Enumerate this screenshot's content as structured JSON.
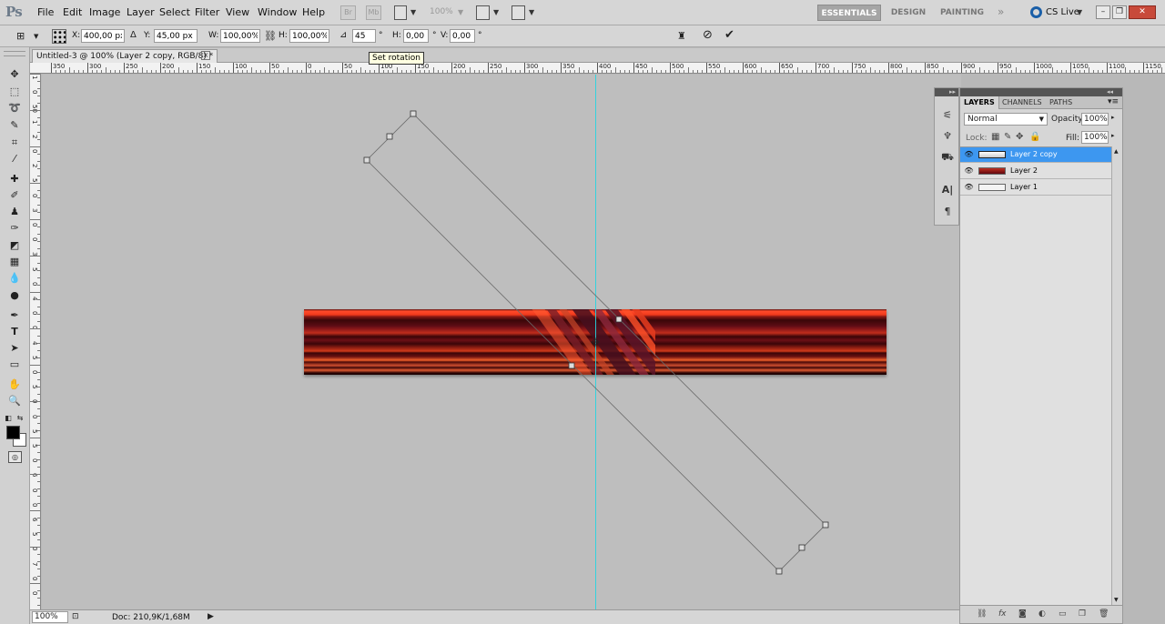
{
  "app": {
    "logo": "Ps"
  },
  "menu": [
    "File",
    "Edit",
    "Image",
    "Layer",
    "Select",
    "Filter",
    "View",
    "Window",
    "Help"
  ],
  "menubar": {
    "zoom": "100%",
    "workspaces": [
      "ESSENTIALS",
      "DESIGN",
      "PAINTING"
    ],
    "more": "»",
    "cs_live": "CS Live",
    "window_controls": [
      "–",
      "❐",
      "✕"
    ]
  },
  "options": {
    "x_label": "X:",
    "x_value": "400,00 px",
    "y_label": "Y:",
    "y_value": "45,00 px",
    "w_label": "W:",
    "w_value": "100,00%",
    "h_label": "H:",
    "h_value": "100,00%",
    "angle_value": "45",
    "degree": "°",
    "hskew_label": "H:",
    "hskew_value": "0,00",
    "vskew_label": "V:",
    "vskew_value": "0,00",
    "tooltip": "Set rotation"
  },
  "document": {
    "tab_title": "Untitled-3 @ 100% (Layer 2 copy, RGB/8) *",
    "close": "×"
  },
  "rulers": {
    "h_labels": [
      "350",
      "300",
      "250",
      "200",
      "150",
      "100",
      "50",
      "0",
      "50",
      "100",
      "150",
      "200",
      "250",
      "300",
      "350",
      "400",
      "450",
      "500",
      "550",
      "600",
      "650",
      "700",
      "750",
      "800",
      "850",
      "900",
      "950",
      "1000",
      "1050",
      "1100",
      "1150"
    ],
    "v_labels": [
      "1",
      "0",
      "50",
      "1",
      "2",
      "0",
      "2",
      "5",
      "0",
      "3",
      "0",
      "0",
      "3",
      "5",
      "0",
      "4",
      "0",
      "0",
      "4",
      "5",
      "0",
      "5",
      "0",
      "0",
      "5",
      "5",
      "0",
      "6",
      "0",
      "0",
      "6",
      "5",
      "0",
      "7",
      "0",
      "0"
    ]
  },
  "status": {
    "zoom": "100%",
    "doc": "Doc: 210,9K/1,68M",
    "arrow": "▶"
  },
  "layers": {
    "tabs": [
      "LAYERS",
      "CHANNELS",
      "PATHS"
    ],
    "blend_mode": "Normal",
    "opacity_label": "Opacity:",
    "opacity": "100%",
    "lock_label": "Lock:",
    "fill_label": "Fill:",
    "fill": "100%",
    "items": [
      {
        "name": "Layer 2 copy",
        "selected": true
      },
      {
        "name": "Layer 2",
        "selected": false
      },
      {
        "name": "Layer 1",
        "selected": false
      }
    ]
  },
  "colors": {
    "guide": "#25d5e0",
    "selection": "#3d97f0",
    "artwork_red": "#ff4a2a",
    "artwork_dark": "#3a0508"
  }
}
